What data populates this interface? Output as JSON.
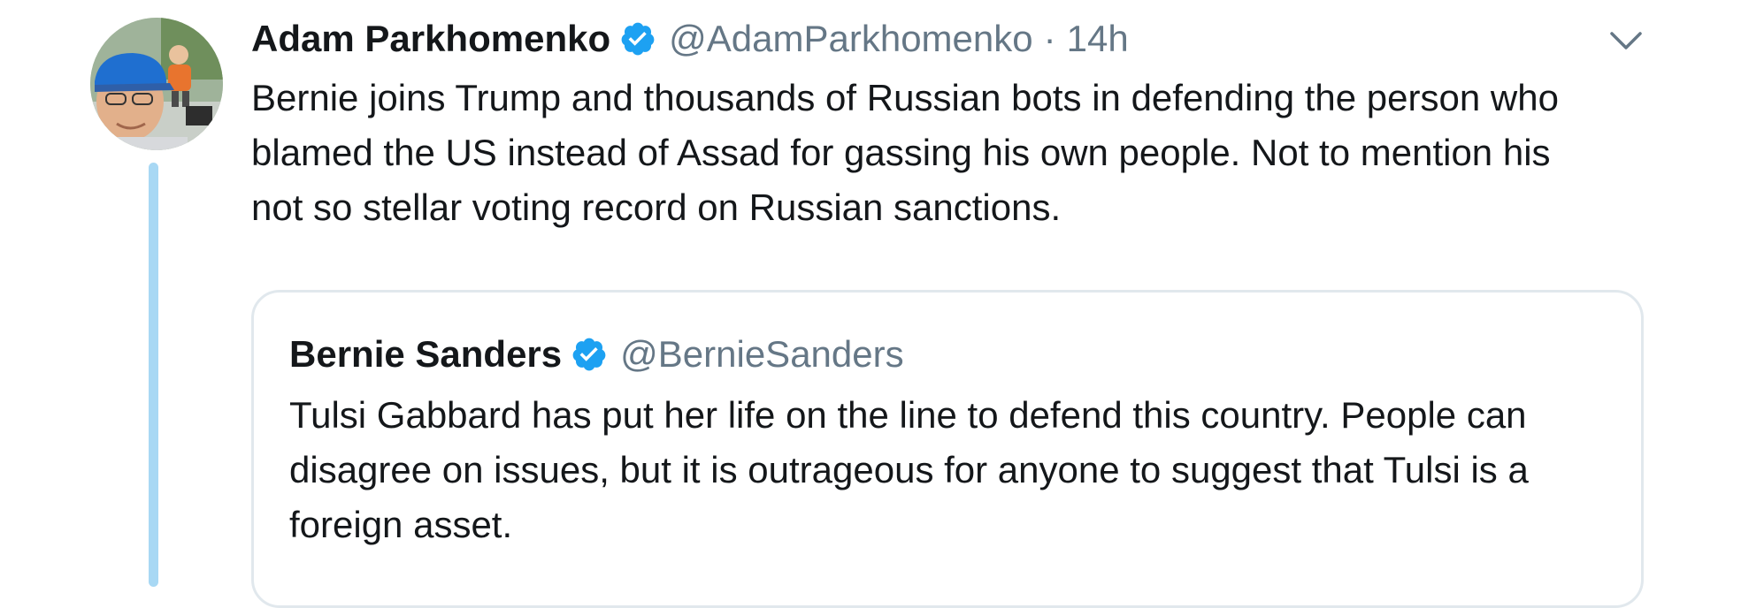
{
  "tweet": {
    "author_name": "Adam Parkhomenko",
    "author_handle": "@AdamParkhomenko",
    "separator": "·",
    "time": "14h",
    "verified_icon": "verified-badge-icon",
    "caret_icon": "chevron-down-icon",
    "text_lines": [
      "Bernie joins Trump and thousands of Russian bots in defending the person who",
      "blamed the US instead of Assad for gassing his own people. Not to mention his",
      "not so stellar voting record on Russian sanctions."
    ]
  },
  "quote": {
    "author_name": "Bernie Sanders",
    "author_handle": "@BernieSanders",
    "verified_icon": "verified-badge-icon",
    "text_lines": [
      "Tulsi Gabbard has put her life on the line to defend this country. People can",
      "disagree on issues, but it is outrageous for anyone to suggest that Tulsi is a",
      "foreign asset."
    ]
  },
  "colors": {
    "verified": "#1da1f2",
    "thread_line": "#a8d8f4",
    "handle": "#657786",
    "text": "#14171a",
    "quote_border": "#e1e8ed"
  }
}
